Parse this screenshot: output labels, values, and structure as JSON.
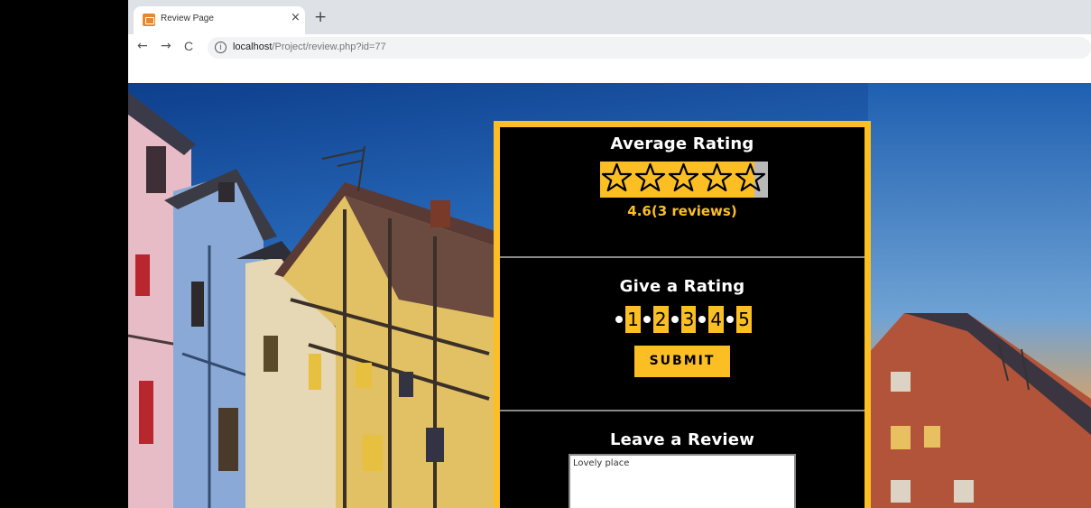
{
  "browser": {
    "tab_title": "Review Page",
    "tab_close": "×",
    "new_tab": "+",
    "back": "←",
    "forward": "→",
    "reload": "C",
    "info": "i",
    "url_host": "localhost",
    "url_path": "/Project/review.php?id=77"
  },
  "average": {
    "title": "Average Rating",
    "rating": 4.6,
    "max": 5,
    "text": "4.6(3 reviews)"
  },
  "give": {
    "title": "Give a Rating",
    "options": [
      "1",
      "2",
      "3",
      "4",
      "5"
    ],
    "submit_label": "SUBMIT"
  },
  "review": {
    "title": "Leave a Review",
    "value": "Lovely place"
  },
  "colors": {
    "accent": "#fbbf24",
    "card_bg": "#000000",
    "star_empty_bg": "#b9b9b9"
  }
}
